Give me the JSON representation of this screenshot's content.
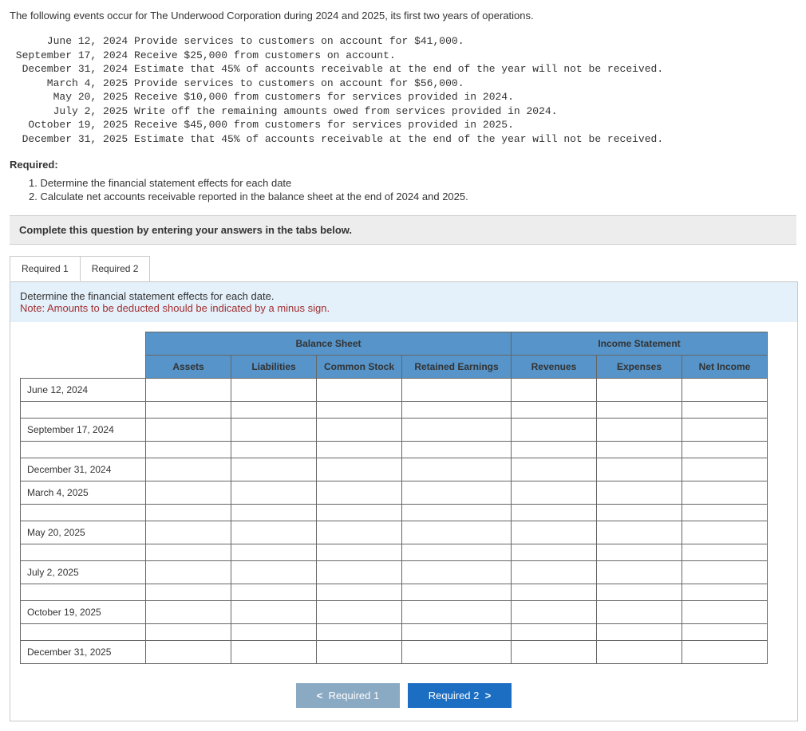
{
  "intro": "The following events occur for The Underwood Corporation during 2024 and 2025, its first two years of operations.",
  "events": [
    {
      "date": "June 12, 2024",
      "desc": "Provide services to customers on account for $41,000."
    },
    {
      "date": "September 17, 2024",
      "desc": "Receive $25,000 from customers on account."
    },
    {
      "date": "December 31, 2024",
      "desc": "Estimate that 45% of accounts receivable at the end of the year will not be received."
    },
    {
      "date": "March 4, 2025",
      "desc": "Provide services to customers on account for $56,000."
    },
    {
      "date": "May 20, 2025",
      "desc": "Receive $10,000 from customers for services provided in 2024."
    },
    {
      "date": "July 2, 2025",
      "desc": "Write off the remaining amounts owed from services provided in 2024."
    },
    {
      "date": "October 19, 2025",
      "desc": "Receive $45,000 from customers for services provided in 2025."
    },
    {
      "date": "December 31, 2025",
      "desc": "Estimate that 45% of accounts receivable at the end of the year will not be received."
    }
  ],
  "required_heading": "Required:",
  "required_items": [
    "1. Determine the financial statement effects for each date",
    "2. Calculate net accounts receivable reported in the balance sheet at the end of 2024 and 2025."
  ],
  "instruction": "Complete this question by entering your answers in the tabs below.",
  "tabs": {
    "t1": "Required 1",
    "t2": "Required 2"
  },
  "tab1": {
    "desc": "Determine the financial statement effects for each date.",
    "note": "Note: Amounts to be deducted should be indicated by a minus sign."
  },
  "table": {
    "group1": "Balance Sheet",
    "group2": "Income Statement",
    "cols": {
      "assets": "Assets",
      "liabilities": "Liabilities",
      "common_stock": "Common Stock",
      "retained_earnings": "Retained Earnings",
      "revenues": "Revenues",
      "expenses": "Expenses",
      "net_income": "Net Income"
    },
    "rows": [
      "June 12, 2024",
      "September 17, 2024",
      "December 31, 2024",
      "March 4, 2025",
      "May 20, 2025",
      "July 2, 2025",
      "October 19, 2025",
      "December 31, 2025"
    ]
  },
  "nav": {
    "prev": "Required 1",
    "next": "Required 2"
  }
}
